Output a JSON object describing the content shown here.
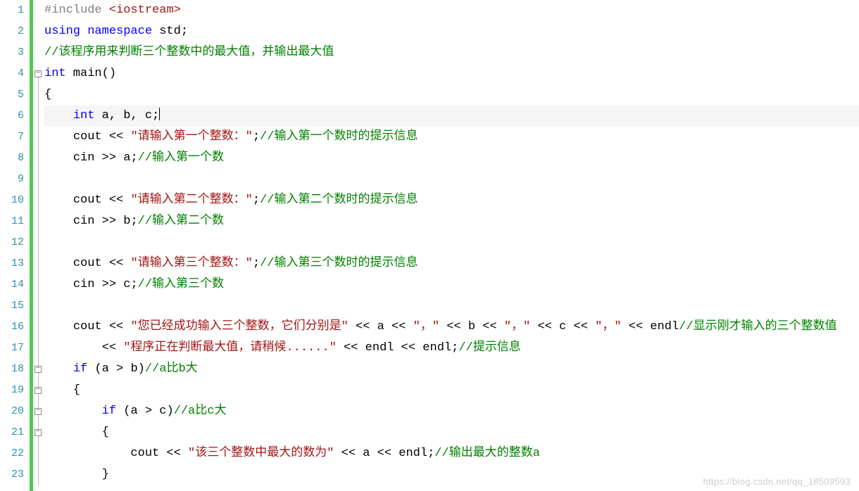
{
  "lineNumbers": [
    "1",
    "2",
    "3",
    "4",
    "5",
    "6",
    "7",
    "8",
    "9",
    "10",
    "11",
    "12",
    "13",
    "14",
    "15",
    "16",
    "17",
    "18",
    "19",
    "20",
    "21",
    "22",
    "23"
  ],
  "currentLine": 6,
  "foldMarkers": [
    {
      "line": 4
    },
    {
      "line": 18
    },
    {
      "line": 19
    },
    {
      "line": 20
    },
    {
      "line": 21
    }
  ],
  "foldLines": [
    {
      "from": 4,
      "to": 23
    }
  ],
  "watermark": "https://blog.csdn.net/qq_18509593",
  "lines": [
    [
      {
        "cls": "tok-pp",
        "t": "#include "
      },
      {
        "cls": "tok-inc",
        "t": "<iostream>"
      }
    ],
    [
      {
        "cls": "tok-kw",
        "t": "using namespace"
      },
      {
        "cls": "tok-id",
        "t": " std"
      },
      {
        "cls": "tok-pl",
        "t": ";"
      }
    ],
    [
      {
        "cls": "tok-cm",
        "t": "//该程序用来判断三个整数中的最大值，并输出最大值"
      }
    ],
    [
      {
        "cls": "tok-kw",
        "t": "int"
      },
      {
        "cls": "tok-id",
        "t": " main"
      },
      {
        "cls": "tok-pl",
        "t": "()"
      }
    ],
    [
      {
        "cls": "tok-pl",
        "t": "{"
      }
    ],
    [
      {
        "cls": "tok-pl",
        "t": "    "
      },
      {
        "cls": "tok-kw",
        "t": "int"
      },
      {
        "cls": "tok-id",
        "t": " a"
      },
      {
        "cls": "tok-pl",
        "t": ", "
      },
      {
        "cls": "tok-id",
        "t": "b"
      },
      {
        "cls": "tok-pl",
        "t": ", "
      },
      {
        "cls": "tok-id",
        "t": "c"
      },
      {
        "cls": "tok-pl",
        "t": ";"
      },
      {
        "cls": "cursor",
        "t": ""
      }
    ],
    [
      {
        "cls": "tok-pl",
        "t": "    "
      },
      {
        "cls": "tok-id",
        "t": "cout"
      },
      {
        "cls": "tok-op",
        "t": " << "
      },
      {
        "cls": "tok-str",
        "t": "\"请输入第一个整数：\""
      },
      {
        "cls": "tok-pl",
        "t": ";"
      },
      {
        "cls": "tok-cm",
        "t": "//输入第一个数时的提示信息"
      }
    ],
    [
      {
        "cls": "tok-pl",
        "t": "    "
      },
      {
        "cls": "tok-id",
        "t": "cin"
      },
      {
        "cls": "tok-op",
        "t": " >> "
      },
      {
        "cls": "tok-id",
        "t": "a"
      },
      {
        "cls": "tok-pl",
        "t": ";"
      },
      {
        "cls": "tok-cm",
        "t": "//输入第一个数"
      }
    ],
    [
      {
        "cls": "tok-pl",
        "t": ""
      }
    ],
    [
      {
        "cls": "tok-pl",
        "t": "    "
      },
      {
        "cls": "tok-id",
        "t": "cout"
      },
      {
        "cls": "tok-op",
        "t": " << "
      },
      {
        "cls": "tok-str",
        "t": "\"请输入第二个整数：\""
      },
      {
        "cls": "tok-pl",
        "t": ";"
      },
      {
        "cls": "tok-cm",
        "t": "//输入第二个数时的提示信息"
      }
    ],
    [
      {
        "cls": "tok-pl",
        "t": "    "
      },
      {
        "cls": "tok-id",
        "t": "cin"
      },
      {
        "cls": "tok-op",
        "t": " >> "
      },
      {
        "cls": "tok-id",
        "t": "b"
      },
      {
        "cls": "tok-pl",
        "t": ";"
      },
      {
        "cls": "tok-cm",
        "t": "//输入第二个数"
      }
    ],
    [
      {
        "cls": "tok-pl",
        "t": ""
      }
    ],
    [
      {
        "cls": "tok-pl",
        "t": "    "
      },
      {
        "cls": "tok-id",
        "t": "cout"
      },
      {
        "cls": "tok-op",
        "t": " << "
      },
      {
        "cls": "tok-str",
        "t": "\"请输入第三个整数：\""
      },
      {
        "cls": "tok-pl",
        "t": ";"
      },
      {
        "cls": "tok-cm",
        "t": "//输入第三个数时的提示信息"
      }
    ],
    [
      {
        "cls": "tok-pl",
        "t": "    "
      },
      {
        "cls": "tok-id",
        "t": "cin"
      },
      {
        "cls": "tok-op",
        "t": " >> "
      },
      {
        "cls": "tok-id",
        "t": "c"
      },
      {
        "cls": "tok-pl",
        "t": ";"
      },
      {
        "cls": "tok-cm",
        "t": "//输入第三个数"
      }
    ],
    [
      {
        "cls": "tok-pl",
        "t": ""
      }
    ],
    [
      {
        "cls": "tok-pl",
        "t": "    "
      },
      {
        "cls": "tok-id",
        "t": "cout"
      },
      {
        "cls": "tok-op",
        "t": " << "
      },
      {
        "cls": "tok-str",
        "t": "\"您已经成功输入三个整数，它们分别是\""
      },
      {
        "cls": "tok-op",
        "t": " << "
      },
      {
        "cls": "tok-id",
        "t": "a"
      },
      {
        "cls": "tok-op",
        "t": " << "
      },
      {
        "cls": "tok-str",
        "t": "\"，\""
      },
      {
        "cls": "tok-op",
        "t": " << "
      },
      {
        "cls": "tok-id",
        "t": "b"
      },
      {
        "cls": "tok-op",
        "t": " << "
      },
      {
        "cls": "tok-str",
        "t": "\"，\""
      },
      {
        "cls": "tok-op",
        "t": " << "
      },
      {
        "cls": "tok-id",
        "t": "c"
      },
      {
        "cls": "tok-op",
        "t": " << "
      },
      {
        "cls": "tok-str",
        "t": "\"，\""
      },
      {
        "cls": "tok-op",
        "t": " << "
      },
      {
        "cls": "tok-id",
        "t": "endl"
      },
      {
        "cls": "tok-cm",
        "t": "//显示刚才输入的三个整数值"
      }
    ],
    [
      {
        "cls": "tok-pl",
        "t": "        "
      },
      {
        "cls": "tok-op",
        "t": "<< "
      },
      {
        "cls": "tok-str",
        "t": "\"程序正在判断最大值，请稍候......\""
      },
      {
        "cls": "tok-op",
        "t": " << "
      },
      {
        "cls": "tok-id",
        "t": "endl"
      },
      {
        "cls": "tok-op",
        "t": " << "
      },
      {
        "cls": "tok-id",
        "t": "endl"
      },
      {
        "cls": "tok-pl",
        "t": ";"
      },
      {
        "cls": "tok-cm",
        "t": "//提示信息"
      }
    ],
    [
      {
        "cls": "tok-pl",
        "t": "    "
      },
      {
        "cls": "tok-kw",
        "t": "if"
      },
      {
        "cls": "tok-pl",
        "t": " ("
      },
      {
        "cls": "tok-id",
        "t": "a"
      },
      {
        "cls": "tok-op",
        "t": " > "
      },
      {
        "cls": "tok-id",
        "t": "b"
      },
      {
        "cls": "tok-pl",
        "t": ")"
      },
      {
        "cls": "tok-cm",
        "t": "//a比b大"
      }
    ],
    [
      {
        "cls": "tok-pl",
        "t": "    {"
      }
    ],
    [
      {
        "cls": "tok-pl",
        "t": "        "
      },
      {
        "cls": "tok-kw",
        "t": "if"
      },
      {
        "cls": "tok-pl",
        "t": " ("
      },
      {
        "cls": "tok-id",
        "t": "a"
      },
      {
        "cls": "tok-op",
        "t": " > "
      },
      {
        "cls": "tok-id",
        "t": "c"
      },
      {
        "cls": "tok-pl",
        "t": ")"
      },
      {
        "cls": "tok-cm",
        "t": "//a比c大"
      }
    ],
    [
      {
        "cls": "tok-pl",
        "t": "        {"
      }
    ],
    [
      {
        "cls": "tok-pl",
        "t": "            "
      },
      {
        "cls": "tok-id",
        "t": "cout"
      },
      {
        "cls": "tok-op",
        "t": " << "
      },
      {
        "cls": "tok-str",
        "t": "\"该三个整数中最大的数为\""
      },
      {
        "cls": "tok-op",
        "t": " << "
      },
      {
        "cls": "tok-id",
        "t": "a"
      },
      {
        "cls": "tok-op",
        "t": " << "
      },
      {
        "cls": "tok-id",
        "t": "endl"
      },
      {
        "cls": "tok-pl",
        "t": ";"
      },
      {
        "cls": "tok-cm",
        "t": "//输出最大的整数a"
      }
    ],
    [
      {
        "cls": "tok-pl",
        "t": "        }"
      }
    ]
  ]
}
